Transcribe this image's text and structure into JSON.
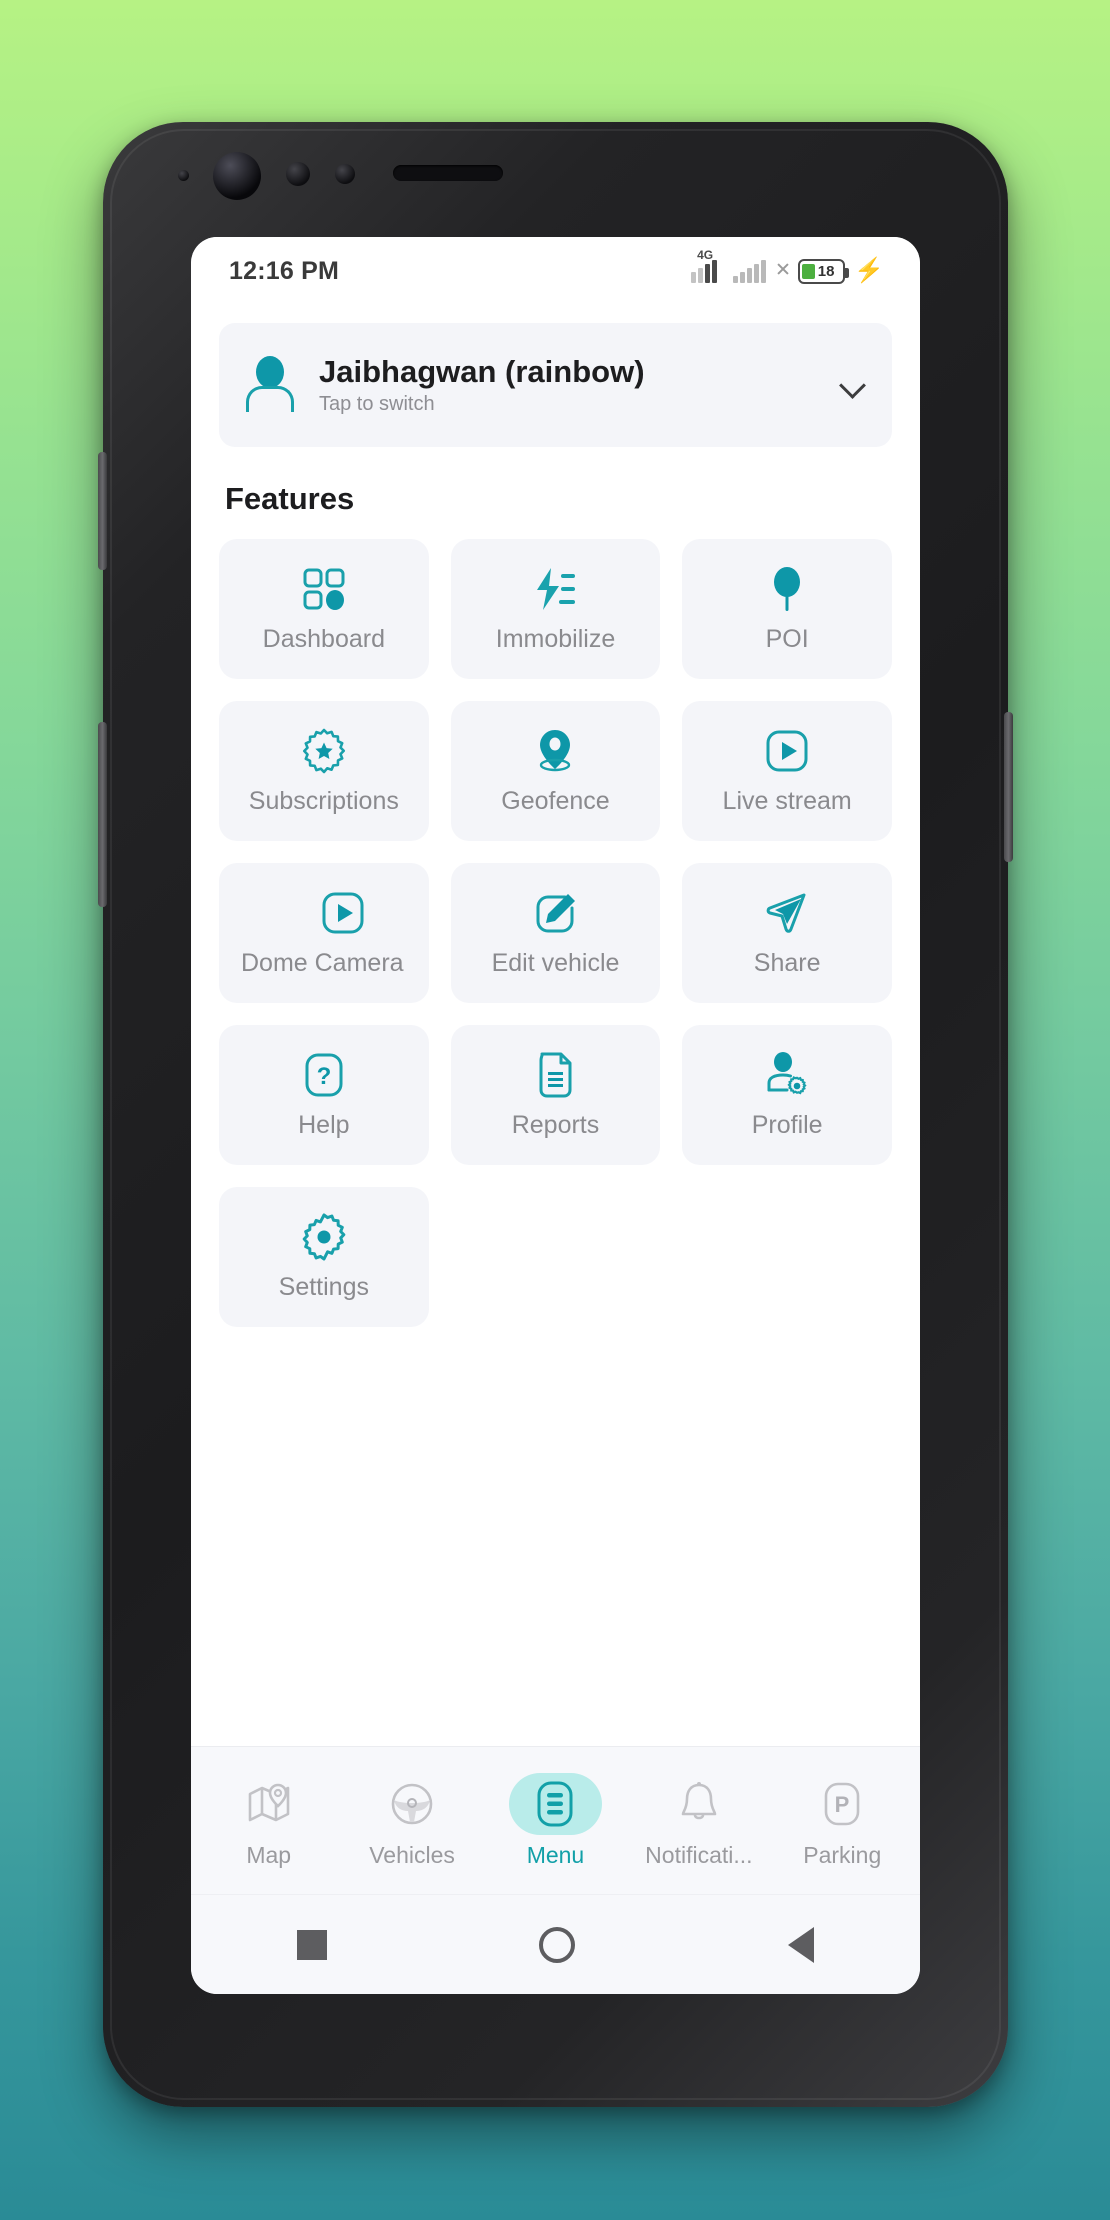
{
  "statusbar": {
    "time": "12:16 PM",
    "network_label": "4G",
    "battery_level": "18"
  },
  "account": {
    "name": "Jaibhagwan (rainbow)",
    "subtitle": "Tap to switch"
  },
  "features": {
    "heading": "Features",
    "tiles": [
      {
        "label": "Dashboard",
        "icon": "grid-icon"
      },
      {
        "label": "Immobilize",
        "icon": "bolt-icon"
      },
      {
        "label": "POI",
        "icon": "balloon-pin-icon"
      },
      {
        "label": "Subscriptions",
        "icon": "star-badge-icon"
      },
      {
        "label": "Geofence",
        "icon": "location-pin-icon"
      },
      {
        "label": "Live stream",
        "icon": "play-square-icon"
      },
      {
        "label": "Dome Camera",
        "icon": "play-square-icon"
      },
      {
        "label": "Edit vehicle",
        "icon": "pencil-square-icon"
      },
      {
        "label": "Share",
        "icon": "paper-plane-icon"
      },
      {
        "label": "Help",
        "icon": "question-square-icon"
      },
      {
        "label": "Reports",
        "icon": "document-icon"
      },
      {
        "label": "Profile",
        "icon": "person-gear-icon"
      },
      {
        "label": "Settings",
        "icon": "gear-icon"
      }
    ]
  },
  "bottom_nav": {
    "items": [
      {
        "label": "Map",
        "icon": "map-pin-icon",
        "active": false
      },
      {
        "label": "Vehicles",
        "icon": "steering-wheel-icon",
        "active": false
      },
      {
        "label": "Menu",
        "icon": "list-menu-icon",
        "active": true
      },
      {
        "label": "Notificati...",
        "icon": "bell-icon",
        "active": false
      },
      {
        "label": "Parking",
        "icon": "parking-p-icon",
        "active": false
      }
    ]
  },
  "android_nav": {
    "recents": "square-icon",
    "home": "circle-icon",
    "back": "triangle-back-icon"
  },
  "colors": {
    "accent": "#0e97a8",
    "accent_light": "#b9ecea",
    "tile_bg": "#f4f5f9",
    "label": "#8a8a8e",
    "bg_top": "#b6f284",
    "bg_bottom": "#2a8b96"
  }
}
